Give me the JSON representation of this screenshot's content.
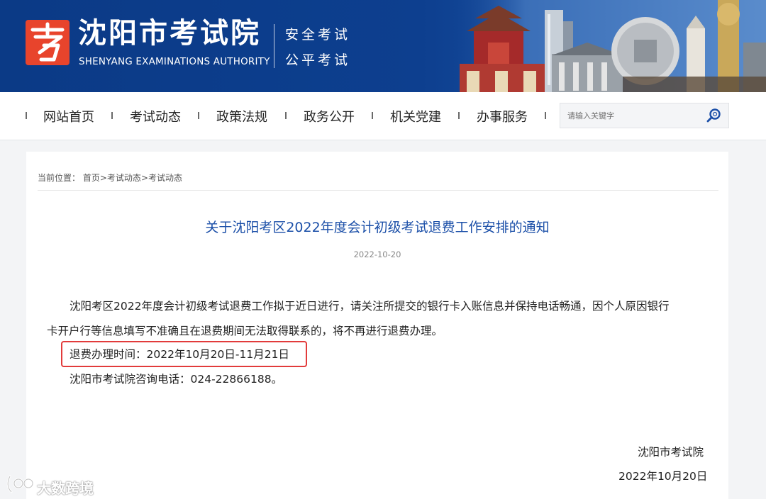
{
  "header": {
    "org_name_cn": "沈阳市考试院",
    "org_name_en": "SHENYANG EXAMINATIONS AUTHORITY",
    "slogan_1": "安全考试",
    "slogan_2": "公平考试",
    "logo_glyph": "考"
  },
  "nav": {
    "items": [
      {
        "label": "网站首页"
      },
      {
        "label": "考试动态"
      },
      {
        "label": "政策法规"
      },
      {
        "label": "政务公开"
      },
      {
        "label": "机关党建"
      },
      {
        "label": "办事服务"
      }
    ],
    "search": {
      "placeholder": "请输入关键字",
      "icon": "search-icon"
    }
  },
  "breadcrumb": {
    "prefix": "当前位置：",
    "items": [
      "首页",
      "考试动态",
      "考试动态"
    ],
    "separator": ">"
  },
  "article": {
    "title": "关于沈阳考区2022年度会计初级考试退费工作安排的通知",
    "date": "2022-10-20",
    "body_line_1": "沈阳考区2022年度会计初级考试退费工作拟于近日进行，请关注所提交的银行卡入账信息并保持电话畅通，因个人原因银行",
    "body_line_2": "卡开户行等信息填写不准确且在退费期间无法取得联系的，将不再进行退费办理。",
    "refund_period": "退费办理时间：2022年10月20日-11月21日",
    "contact": "沈阳市考试院咨询电话：024-22866188。",
    "signature_org": "沈阳市考试院",
    "signature_date": "2022年10月20日"
  },
  "watermark": {
    "text": "大数跨境"
  },
  "colors": {
    "brand_blue": "#0b3a86",
    "title_blue": "#1b4fa8",
    "highlight_red": "#e23b3b",
    "logo_red": "#e8442c"
  }
}
